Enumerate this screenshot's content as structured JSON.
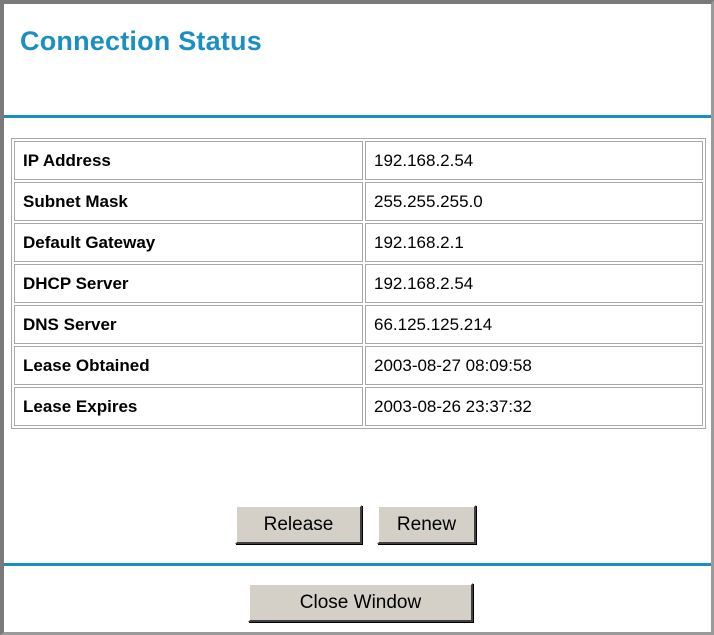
{
  "window": {
    "title": "Connection Status"
  },
  "rows": [
    {
      "label": "IP Address",
      "value": "192.168.2.54"
    },
    {
      "label": "Subnet Mask",
      "value": "255.255.255.0"
    },
    {
      "label": "Default Gateway",
      "value": "192.168.2.1"
    },
    {
      "label": "DHCP Server",
      "value": "192.168.2.54"
    },
    {
      "label": "DNS Server",
      "value": "66.125.125.214"
    },
    {
      "label": "Lease Obtained",
      "value": "2003-08-27 08:09:58"
    },
    {
      "label": "Lease Expires",
      "value": "2003-08-26 23:37:32"
    }
  ],
  "buttons": {
    "release": "Release",
    "renew": "Renew",
    "close": "Close Window"
  },
  "colors": {
    "accent": "#1b8fc4",
    "button_face": "#d4d0c8",
    "cell_border": "#a8a8a8"
  }
}
